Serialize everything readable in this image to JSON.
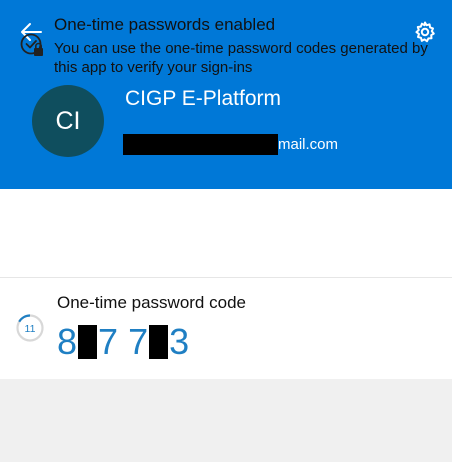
{
  "header": {
    "account_name": "CIGP E-Platform",
    "email_suffix": "mail.com",
    "avatar_initials": "CI",
    "back_icon": "back-arrow-icon",
    "settings_icon": "gear-icon"
  },
  "otp_status": {
    "title": "One-time passwords enabled",
    "description": "You can use the one-time password codes generated by this app to verify your sign-ins",
    "icon": "shield-check-icon"
  },
  "otp_code": {
    "label": "One-time password code",
    "timer_seconds": "11",
    "digits": [
      "8",
      "7",
      "7",
      "3"
    ]
  },
  "colors": {
    "header_bg": "#0078d7",
    "avatar_bg": "#0f4e5e",
    "code_text": "#1f7fc3"
  }
}
